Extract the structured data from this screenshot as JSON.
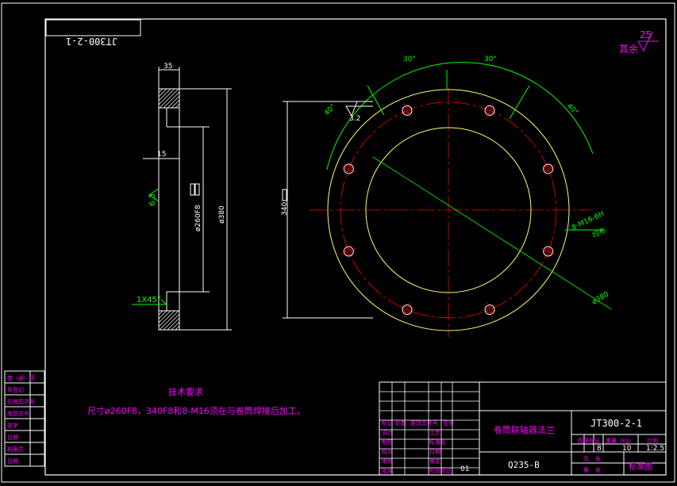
{
  "drawing": {
    "code_mirrored": "JT300-2-1",
    "code": "JT300-2-1",
    "part_name": "卷筒联轴器法兰",
    "material": "Q235-B",
    "qty": "8",
    "mass": "10",
    "scale": "1:2.5",
    "sheet_no": "01",
    "standard": "标准图",
    "surface_finish_other": "其余",
    "surface_finish_other_value": "25"
  },
  "tech_req": {
    "title": "技术要求",
    "line1": "尺寸ø260F8，340F8和8-M16须在与卷筒焊接后加工。"
  },
  "dims": {
    "side_width": "35",
    "side_step": "15",
    "chamfer": "1X45°",
    "bore_mark": "ø260F8",
    "outer_mark": "ø380",
    "finish_side": "6.3",
    "pcd": "340",
    "angle_30a": "30°",
    "angle_30b": "30°",
    "angle_40a": "40°",
    "angle_40b": "40°",
    "finish_front": "3.2",
    "holes": "8-M16-6H",
    "holes_note": "均布",
    "dia_outer": "ø380"
  },
  "left_block": {
    "rows": [
      "借（通）用",
      "件登记",
      "旧底图总号",
      "底图总号",
      "签字",
      "日期",
      "档案员",
      "日期"
    ]
  },
  "title_block": {
    "h_mark": "标记",
    "h_count": "处数",
    "h_doc": "更改文件号",
    "h_sign": "签字",
    "r_design": "设计",
    "r_draw": "制图",
    "r_check": "校对",
    "r_review": "审核",
    "r_std": "标准化",
    "r_craft": "工艺",
    "r_approve": "批准",
    "r_date": "日期",
    "r_std2": "标准化",
    "r_audit": "审定",
    "r_drawno": "图样标记",
    "r_weight": "重量（kg）",
    "r_ratio": "比例",
    "r_total": "共",
    "r_page": "张",
    "r_pages": "第",
    "r_sheet": "张",
    "r_sheetno": "阶段标记"
  }
}
